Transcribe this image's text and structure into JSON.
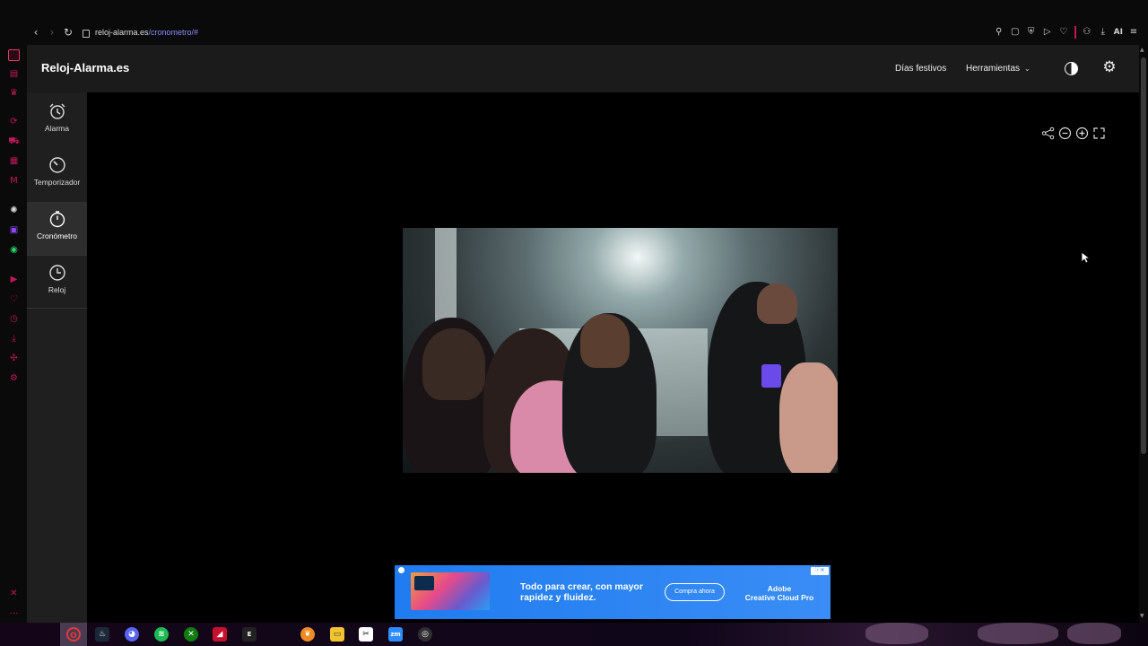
{
  "browser": {
    "url_host": "reloj-alarma.es",
    "url_path": "/cronometro/#",
    "toolbar_ai_label": "AI"
  },
  "header": {
    "logo": "Reloj-Alarma.es",
    "nav": [
      {
        "label": "Días festivos"
      },
      {
        "label": "Herramientas"
      }
    ]
  },
  "sidebar": {
    "items": [
      {
        "label": "Alarma",
        "icon": "alarm-clock-icon",
        "active": false
      },
      {
        "label": "Temporizador",
        "icon": "timer-icon",
        "active": false
      },
      {
        "label": "Cronómetro",
        "icon": "stopwatch-icon",
        "active": true
      },
      {
        "label": "Reloj",
        "icon": "clock-icon",
        "active": false
      }
    ]
  },
  "ad": {
    "headline": "Todo para crear, con mayor rapidez y fluidez.",
    "cta": "Compra ahora",
    "brand_line1": "Adobe",
    "brand_line2": "Creative Cloud Pro"
  },
  "taskbar": {
    "apps": [
      "opera-icon",
      "steam-icon",
      "discord-icon",
      "spotify-icon",
      "xbox-icon",
      "amd-icon",
      "epic-games-icon",
      "fl-studio-icon",
      "file-explorer-icon",
      "capcut-icon",
      "zoom-icon",
      "obs-icon"
    ]
  },
  "colors": {
    "opera_accent": "#c2185b",
    "header_bg": "#1b1b1b",
    "sidebar_bg": "#1f1f1f",
    "ad_blue": "#1f7cf0"
  }
}
